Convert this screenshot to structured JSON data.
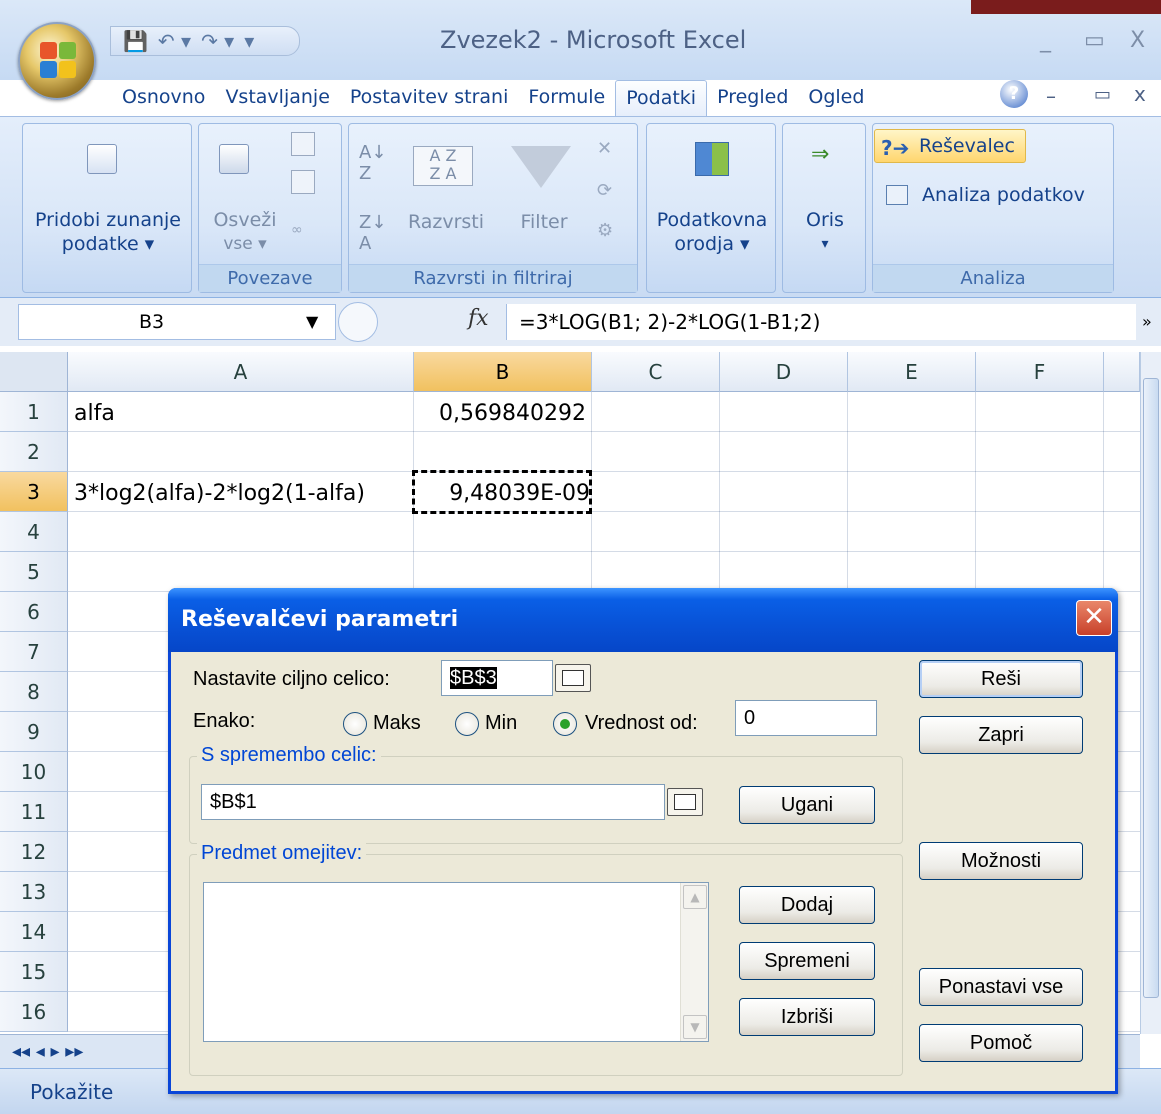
{
  "window": {
    "title": "Zvezek2 - Microsoft Excel",
    "controls": {
      "minimize": "_",
      "maximize": "▭",
      "close": "X"
    }
  },
  "ribbon_tabs": [
    "Osnovno",
    "Vstavljanje",
    "Postavitev strani",
    "Formule",
    "Podatki",
    "Pregled",
    "Ogled"
  ],
  "active_tab": "Podatki",
  "ribbon": {
    "get_external_data": {
      "line1": "Pridobi zunanje",
      "line2": "podatke ▾"
    },
    "connections": {
      "refresh_line1": "Osveži",
      "refresh_line2": "vse ▾",
      "label": "Povezave"
    },
    "sort_filter": {
      "sort": "Razvrsti",
      "filter": "Filter",
      "label": "Razvrsti in filtriraj"
    },
    "data_tools": {
      "line1": "Podatkovna",
      "line2": "orodja ▾"
    },
    "outline": {
      "line1": "Oris",
      "line2": "▾"
    },
    "analysis": {
      "solver": "Reševalec",
      "data_analysis": "Analiza podatkov",
      "label": "Analiza"
    }
  },
  "formula_bar": {
    "name_box": "B3",
    "fx": "fx",
    "formula": "=3*LOG(B1; 2)-2*LOG(1-B1;2)"
  },
  "sheet": {
    "columns": [
      "A",
      "B",
      "C",
      "D",
      "E",
      "F"
    ],
    "rows": [
      "1",
      "2",
      "3",
      "4",
      "5",
      "6",
      "7",
      "8",
      "9",
      "10",
      "11",
      "12",
      "13",
      "14",
      "15",
      "16"
    ],
    "cells": {
      "A1": "alfa",
      "B1": "0,569840292",
      "A3": "3*log2(alfa)-2*log2(1-alfa)",
      "B3": "9,48039E-09"
    },
    "selected_cell": "B3"
  },
  "status_bar": {
    "mode": "Pokažite"
  },
  "dialog": {
    "title": "Reševalčevi parametri",
    "target_label": "Nastavite ciljno celico:",
    "target_value": "$B$3",
    "equal_label": "Enako:",
    "radio_max": "Maks",
    "radio_min": "Min",
    "radio_value": "Vrednost od:",
    "value_of": "0",
    "changing_legend": "S spremembo celic:",
    "changing_value": "$B$1",
    "constraints_legend": "Predmet omejitev:",
    "buttons": {
      "solve": "Reši",
      "close": "Zapri",
      "guess": "Ugani",
      "options": "Možnosti",
      "add": "Dodaj",
      "change": "Spremeni",
      "delete": "Izbriši",
      "reset_all": "Ponastavi vse",
      "help": "Pomoč"
    }
  }
}
